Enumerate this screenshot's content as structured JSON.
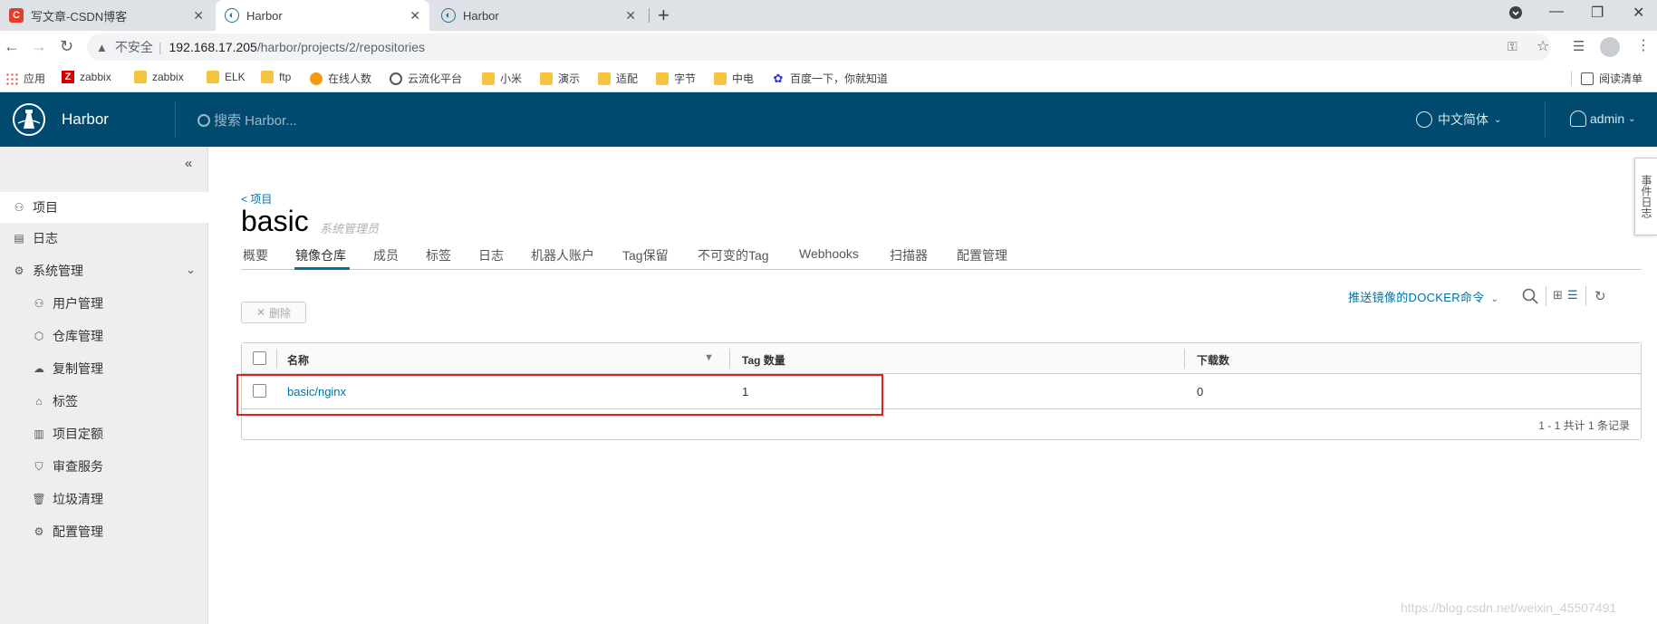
{
  "browser": {
    "tabs": [
      {
        "title": "写文章-CSDN博客",
        "favicon": "csdn-icon",
        "active": false
      },
      {
        "title": "Harbor",
        "favicon": "harbor-icon",
        "active": true
      },
      {
        "title": "Harbor",
        "favicon": "harbor-icon",
        "active": false
      }
    ],
    "address": {
      "security": "不安全",
      "host": "192.168.17.205",
      "path": "/harbor/projects/2/repositories"
    },
    "bookmarks": [
      {
        "label": "应用",
        "icon": "apps-grid-icon"
      },
      {
        "label": "zabbix",
        "icon": "zabbix-icon"
      },
      {
        "label": "zabbix",
        "icon": "folder-icon"
      },
      {
        "label": "ELK",
        "icon": "folder-icon"
      },
      {
        "label": "ftp",
        "icon": "folder-icon"
      },
      {
        "label": "在线人数",
        "icon": "sun-icon"
      },
      {
        "label": "云流化平台",
        "icon": "globe-icon"
      },
      {
        "label": "小米",
        "icon": "folder-icon"
      },
      {
        "label": "演示",
        "icon": "folder-icon"
      },
      {
        "label": "适配",
        "icon": "folder-icon"
      },
      {
        "label": "字节",
        "icon": "folder-icon"
      },
      {
        "label": "中电",
        "icon": "folder-icon"
      },
      {
        "label": "百度一下，你就知道",
        "icon": "baidu-icon"
      }
    ],
    "reading_list": "阅读清单"
  },
  "header": {
    "brand": "Harbor",
    "search_placeholder": "搜索 Harbor...",
    "language": "中文简体",
    "user": "admin"
  },
  "sidebar": {
    "items": [
      {
        "label": "项目",
        "icon": "project-icon",
        "active": true
      },
      {
        "label": "日志",
        "icon": "log-icon"
      },
      {
        "label": "系统管理",
        "icon": "admin-icon",
        "expandable": true
      }
    ],
    "sub_items": [
      {
        "label": "用户管理",
        "icon": "users-icon"
      },
      {
        "label": "仓库管理",
        "icon": "registry-icon"
      },
      {
        "label": "复制管理",
        "icon": "cloud-replicate-icon"
      },
      {
        "label": "标签",
        "icon": "tag-icon"
      },
      {
        "label": "项目定额",
        "icon": "quota-icon"
      },
      {
        "label": "审查服务",
        "icon": "shield-icon"
      },
      {
        "label": "垃圾清理",
        "icon": "trash-icon"
      },
      {
        "label": "配置管理",
        "icon": "gear-icon"
      }
    ]
  },
  "project": {
    "breadcrumb": "< 项目",
    "name": "basic",
    "role": "系统管理员",
    "tabs": [
      "概要",
      "镜像仓库",
      "成员",
      "标签",
      "日志",
      "机器人账户",
      "Tag保留",
      "不可变的Tag",
      "Webhooks",
      "扫描器",
      "配置管理"
    ],
    "active_tab": "镜像仓库"
  },
  "toolbar": {
    "delete_label": "删除",
    "push_command": "推送镜像的DOCKER命令"
  },
  "grid": {
    "columns": [
      "名称",
      "Tag 数量",
      "下载数"
    ],
    "rows": [
      {
        "name": "basic/nginx",
        "tag_count": "1",
        "pulls": "0"
      }
    ],
    "footer": "1 - 1 共计 1 条记录"
  },
  "side_panel": "事件日志",
  "watermark": "https://blog.csdn.net/weixin_45507491",
  "colors": {
    "header_bg": "#004a70",
    "accent": "#0072a3",
    "highlight_border": "#e02020"
  }
}
